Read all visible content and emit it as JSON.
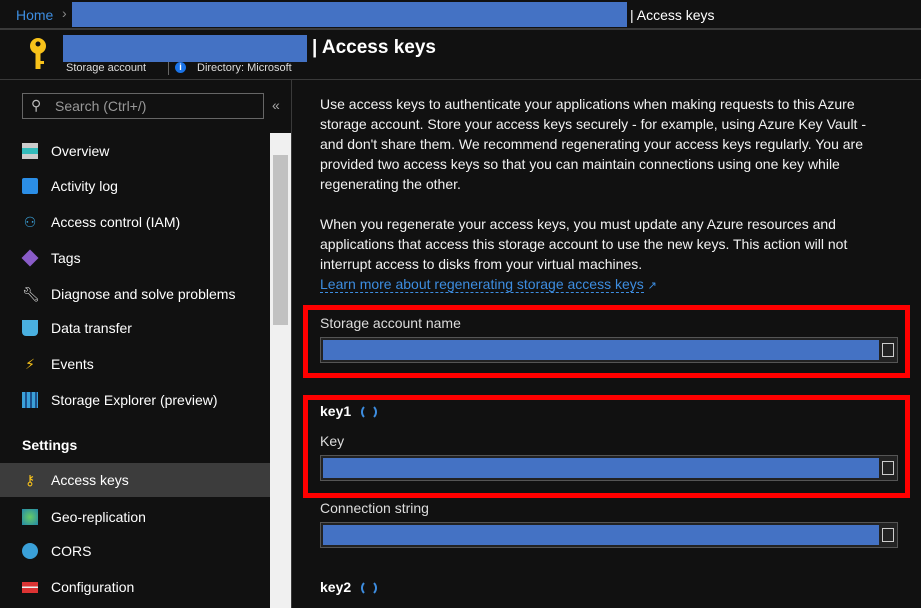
{
  "breadcrumb": {
    "home": "Home",
    "current": "| Access keys"
  },
  "header": {
    "title": "| Access keys",
    "resource_type": "Storage account",
    "directory": "Directory: Microsoft",
    "icon": "key-icon"
  },
  "sidebar": {
    "search_placeholder": "Search (Ctrl+/)",
    "collapse": "«",
    "items": [
      {
        "label": "Overview",
        "icon": "overview-icon"
      },
      {
        "label": "Activity log",
        "icon": "activity-log-icon"
      },
      {
        "label": "Access control (IAM)",
        "icon": "people-icon"
      },
      {
        "label": "Tags",
        "icon": "tag-icon"
      },
      {
        "label": "Diagnose and solve problems",
        "icon": "wrench-icon"
      },
      {
        "label": "Data transfer",
        "icon": "data-transfer-icon"
      },
      {
        "label": "Events",
        "icon": "lightning-icon"
      },
      {
        "label": "Storage Explorer (preview)",
        "icon": "storage-explorer-icon"
      }
    ],
    "section": "Settings",
    "settings_items": [
      {
        "label": "Access keys",
        "icon": "key-icon",
        "active": true
      },
      {
        "label": "Geo-replication",
        "icon": "globe-icon"
      },
      {
        "label": "CORS",
        "icon": "cors-icon"
      },
      {
        "label": "Configuration",
        "icon": "configuration-icon"
      }
    ]
  },
  "main": {
    "para1": "Use access keys to authenticate your applications when making requests to this Azure storage account. Store your access keys securely - for example, using Azure Key Vault - and don't share them. We recommend regenerating your access keys regularly. You are provided two access keys so that you can maintain connections using one key while regenerating the other.",
    "para2": "When you regenerate your access keys, you must update any Azure resources and applications that access this storage account to use the new keys. This action will not interrupt access to disks from your virtual machines.",
    "learn_more": "Learn more about regenerating storage access keys",
    "storage_account_name_label": "Storage account name",
    "key1": "key1",
    "key_label": "Key",
    "connection_string_label": "Connection string",
    "key2": "key2"
  },
  "colors": {
    "accent": "#3d8de0",
    "highlight": "#ff0000",
    "redaction": "#4472c4"
  }
}
